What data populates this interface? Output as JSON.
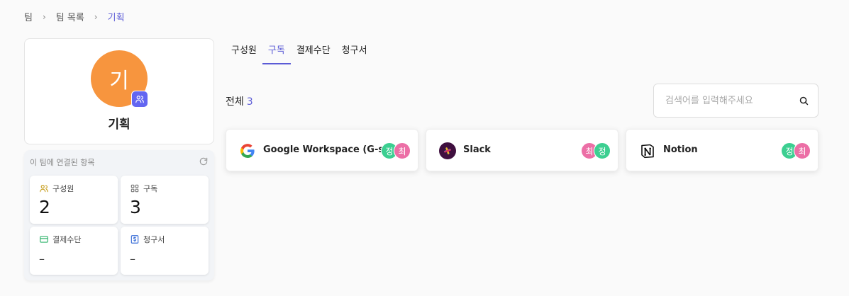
{
  "breadcrumb": [
    "팀",
    "팀 목록",
    "기획"
  ],
  "team": {
    "avatar_initial": "기",
    "name": "기획",
    "avatar_color": "#f7953e"
  },
  "linked": {
    "header": "이 팀에 연결된 항목",
    "stats": [
      {
        "label": "구성원",
        "value": "2",
        "icon": "users-icon"
      },
      {
        "label": "구독",
        "value": "3",
        "icon": "grid-icon"
      },
      {
        "label": "결제수단",
        "value": "–",
        "icon": "card-icon"
      },
      {
        "label": "청구서",
        "value": "–",
        "icon": "invoice-icon"
      }
    ]
  },
  "tabs": [
    {
      "label": "구성원",
      "active": false
    },
    {
      "label": "구독",
      "active": true
    },
    {
      "label": "결제수단",
      "active": false
    },
    {
      "label": "청구서",
      "active": false
    }
  ],
  "total": {
    "label": "전체",
    "count": "3"
  },
  "search": {
    "placeholder": "검색어를 입력해주세요",
    "value": ""
  },
  "subscriptions": [
    {
      "name": "Google Workspace (G-suite)",
      "logo": "google-logo",
      "members": [
        {
          "initial": "정",
          "color": "#3ccf91"
        },
        {
          "initial": "최",
          "color": "#ec6fa6"
        }
      ]
    },
    {
      "name": "Slack",
      "logo": "slack-logo",
      "members": [
        {
          "initial": "최",
          "color": "#ec6fa6"
        },
        {
          "initial": "정",
          "color": "#3ccf91"
        }
      ]
    },
    {
      "name": "Notion",
      "logo": "notion-logo",
      "members": [
        {
          "initial": "정",
          "color": "#3ccf91"
        },
        {
          "initial": "최",
          "color": "#ec6fa6"
        }
      ]
    }
  ],
  "colors": {
    "accent": "#5b5bd6",
    "badge": "#6366f1"
  }
}
